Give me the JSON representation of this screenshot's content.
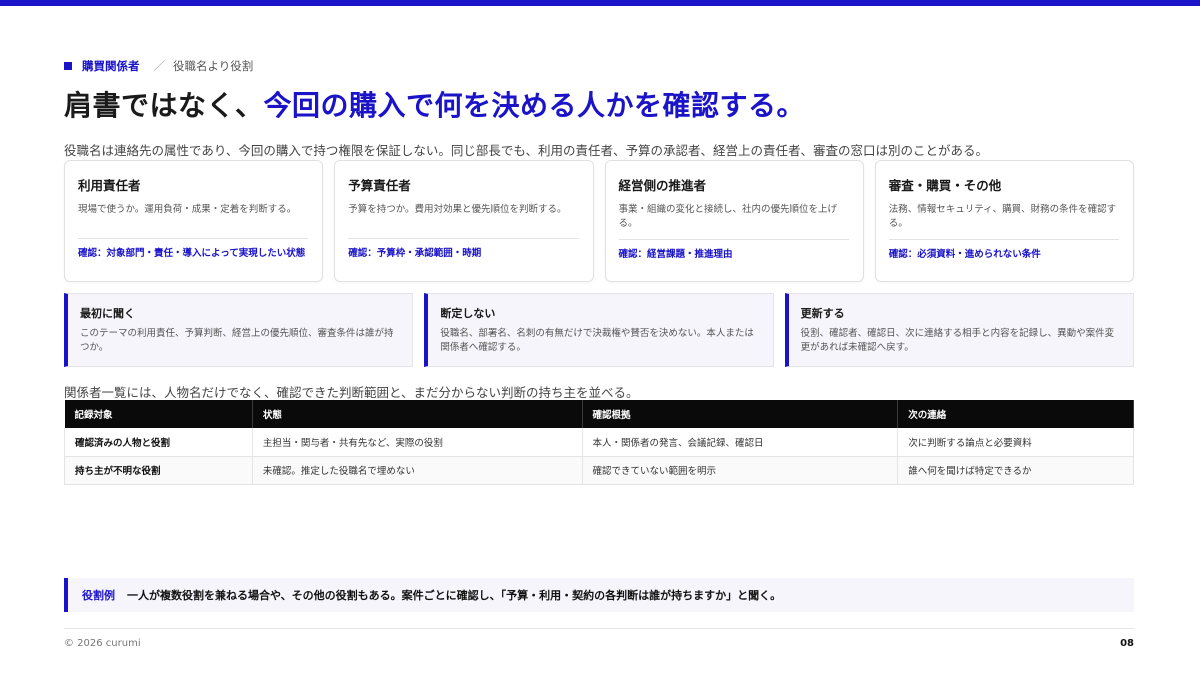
{
  "header": {
    "category": "購買関係者",
    "separator": "／",
    "subtitle": "役職名より役割",
    "title_plain": "肩書ではなく、",
    "title_accent": "今回の購入で何を決める人かを確認する。",
    "lead": "役職名は連絡先の属性であり、今回の購入で持つ権限を保証しない。同じ部長でも、利用の責任者、予算の承認者、経営上の責任者、審査の窓口は別のことがある。"
  },
  "cards": [
    {
      "title": "利用責任者",
      "desc": "現場で使うか。運用負荷・成果・定着を判断する。",
      "confirm": "確認：対象部門・責任・導入によって実現したい状態"
    },
    {
      "title": "予算責任者",
      "desc": "予算を持つか。費用対効果と優先順位を判断する。",
      "confirm": "確認：予算枠・承認範囲・時期"
    },
    {
      "title": "経営側の推進者",
      "desc": "事業・組織の変化と接続し、社内の優先順位を上げる。",
      "confirm": "確認：経営課題・推進理由"
    },
    {
      "title": "審査・購買・その他",
      "desc": "法務、情報セキュリティ、購買、財務の条件を確認する。",
      "confirm": "確認：必須資料・進められない条件"
    }
  ],
  "steps": [
    {
      "title": "最初に聞く",
      "desc": "このテーマの利用責任、予算判断、経営上の優先順位、審査条件は誰が持つか。"
    },
    {
      "title": "断定しない",
      "desc": "役職名、部署名、名刺の有無だけで決裁権や賛否を決めない。本人または関係者へ確認する。"
    },
    {
      "title": "更新する",
      "desc": "役割、確認者、確認日、次に連絡する相手と内容を記録し、異動や案件変更があれば未確認へ戻す。"
    }
  ],
  "table": {
    "lead": "関係者一覧には、人物名だけでなく、確認できた判断範囲と、まだ分からない判断の持ち主を並べる。",
    "headers": [
      "記録対象",
      "状態",
      "確認根拠",
      "次の連絡"
    ],
    "rows": [
      [
        "確認済みの人物と役割",
        "主担当・関与者・共有先など、実際の役割",
        "本人・関係者の発言、会議記録、確認日",
        "次に判断する論点と必要資料"
      ],
      [
        "持ち主が不明な役割",
        "未確認。推定した役職名で埋めない",
        "確認できていない範囲を明示",
        "誰へ何を聞けば特定できるか"
      ]
    ]
  },
  "example": {
    "label": "役割例",
    "text": "一人が複数役割を兼ねる場合や、その他の役割もある。案件ごとに確認し、「予算・利用・契約の各判断は誰が持ちますか」と聞く。"
  },
  "footer": {
    "copyright": "© 2026 curumi",
    "page": "08"
  },
  "colors": {
    "accent": "#1a13c8",
    "table_header": "#0a0a0a"
  }
}
